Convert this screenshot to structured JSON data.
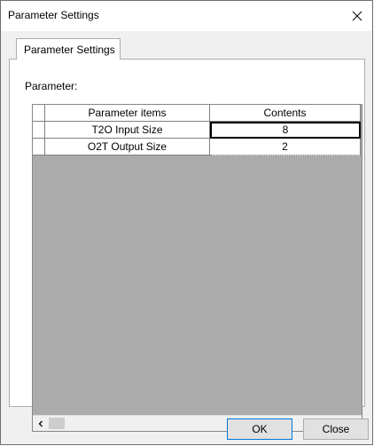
{
  "window": {
    "title": "Parameter Settings"
  },
  "tabs": [
    {
      "label": "Parameter Settings"
    }
  ],
  "parameter_label": "Parameter:",
  "table": {
    "columns": [
      "Parameter items",
      "Contents"
    ],
    "rows": [
      {
        "item": "T2O Input Size",
        "value": "8"
      },
      {
        "item": "O2T Output Size",
        "value": "2"
      }
    ]
  },
  "buttons": {
    "ok": "OK",
    "close": "Close"
  },
  "icons": {
    "close": "close-icon",
    "scroll_left": "chevron-left-icon",
    "scroll_right": "chevron-right-icon"
  }
}
